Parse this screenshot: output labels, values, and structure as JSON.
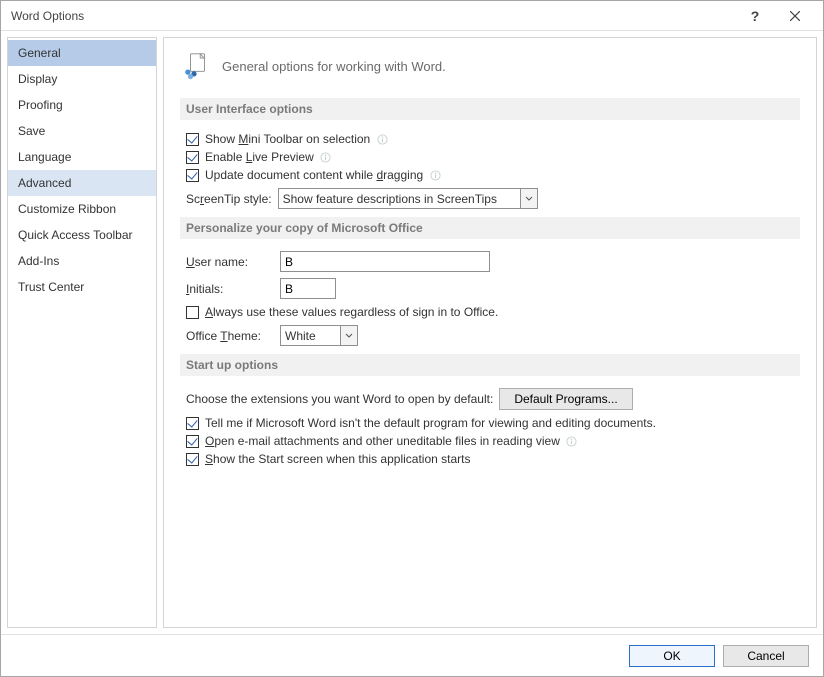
{
  "window": {
    "title": "Word Options"
  },
  "sidebar": {
    "items": [
      "General",
      "Display",
      "Proofing",
      "Save",
      "Language",
      "Advanced",
      "Customize Ribbon",
      "Quick Access Toolbar",
      "Add-Ins",
      "Trust Center"
    ]
  },
  "header": {
    "text": "General options for working with Word."
  },
  "sections": {
    "ui": {
      "title": "User Interface options",
      "show_mini_pre": "Show ",
      "show_mini_u": "M",
      "show_mini_post": "ini Toolbar on selection",
      "live_pre": "Enable ",
      "live_u": "L",
      "live_post": "ive Preview",
      "drag_pre": "Update document content while ",
      "drag_u": "d",
      "drag_post": "ragging",
      "screentip_label_pre": "Sc",
      "screentip_label_u": "r",
      "screentip_label_post": "eenTip style:",
      "screentip_value": "Show feature descriptions in ScreenTips"
    },
    "personalize": {
      "title": "Personalize your copy of Microsoft Office",
      "username_label_u": "U",
      "username_label_post": "ser name:",
      "username_value": "B",
      "initials_label_u": "I",
      "initials_label_post": "nitials:",
      "initials_value": "B",
      "always_u": "A",
      "always_post": "lways use these values regardless of sign in to Office.",
      "theme_pre": "Office ",
      "theme_u": "T",
      "theme_post": "heme:",
      "theme_value": "White"
    },
    "startup": {
      "title": "Start up options",
      "choose_text": "Choose the extensions you want Word to open by default:",
      "default_programs_btn": "Default Programs...",
      "tell_text": "Tell me if Microsoft Word isn't the default program for viewing and editing documents.",
      "open_u": "O",
      "open_post": "pen e-mail attachments and other uneditable files in reading view",
      "show_u": "S",
      "show_post": "how the Start screen when this application starts"
    }
  },
  "footer": {
    "ok": "OK",
    "cancel": "Cancel"
  }
}
